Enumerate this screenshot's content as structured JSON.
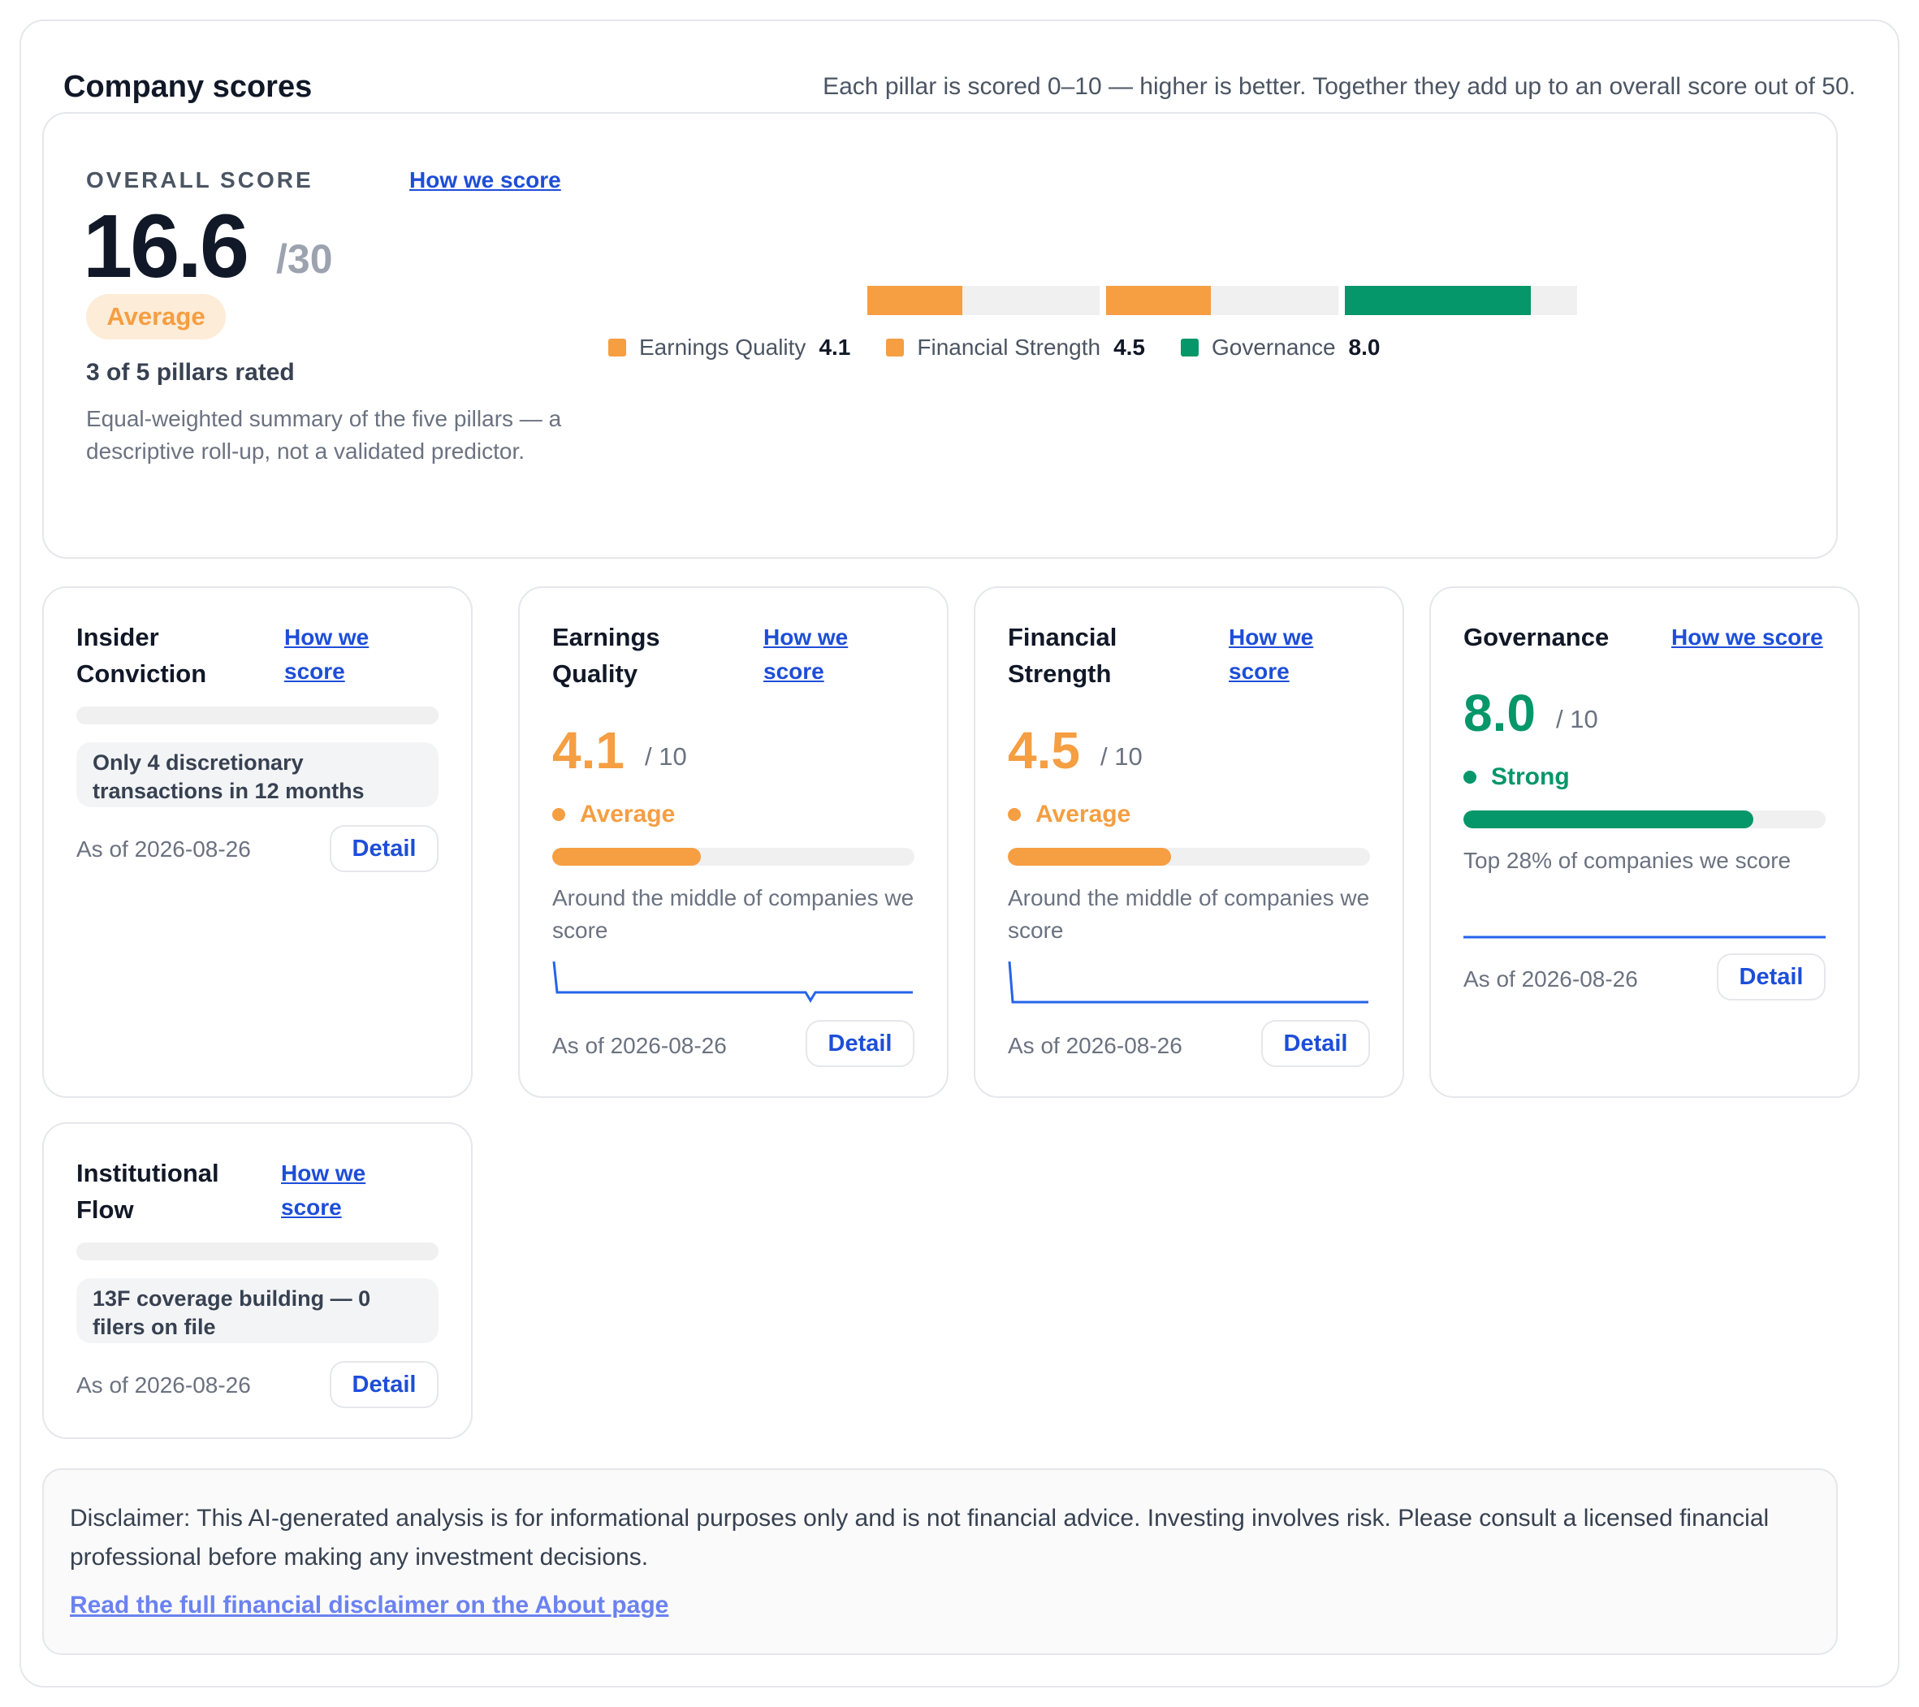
{
  "header": {
    "title": "Company scores",
    "subtitle": "Each pillar is scored 0–10 — higher is better. Together they add up to an overall score out of 50."
  },
  "overall": {
    "label": "OVERALL SCORE",
    "link": "How we score",
    "score": "16.6",
    "max": "/30",
    "band": "Average",
    "rated": "3 of 5 pillars rated",
    "description": "Equal-weighted summary of the five pillars — a descriptive roll-up, not a validated predictor.",
    "segments": [
      {
        "name": "Earnings Quality",
        "value": "4.1",
        "fraction": 0.41,
        "color": "#f59e42"
      },
      {
        "name": "Financial Strength",
        "value": "4.5",
        "fraction": 0.45,
        "color": "#f59e42"
      },
      {
        "name": "Governance",
        "value": "8.0",
        "fraction": 0.8,
        "color": "#059669"
      }
    ]
  },
  "pillars": [
    {
      "title": "Insider Conviction",
      "link": "How we score",
      "note": "Only 4 discretionary transactions in 12 months",
      "as_of": "As of 2026-08-26",
      "detail": "Detail"
    },
    {
      "title": "Earnings Quality",
      "link": "How we score",
      "score": "4.1",
      "max": "/ 10",
      "band": "Average",
      "fraction": 0.41,
      "note": "Around the middle of companies we score",
      "as_of": "As of 2026-08-26",
      "detail": "Detail"
    },
    {
      "title": "Financial Strength",
      "link": "How we score",
      "score": "4.5",
      "max": "/ 10",
      "band": "Average",
      "fraction": 0.45,
      "note": "Around the middle of companies we score",
      "as_of": "As of 2026-08-26",
      "detail": "Detail"
    },
    {
      "title": "Governance",
      "link": "How we score",
      "score": "8.0",
      "max": "/ 10",
      "band": "Strong",
      "fraction": 0.8,
      "note": "Top 28% of companies we score",
      "as_of": "As of 2026-08-26",
      "detail": "Detail"
    },
    {
      "title": "Institutional Flow",
      "link": "How we score",
      "note": "13F coverage building — 0 filers on file",
      "as_of": "As of 2026-08-26",
      "detail": "Detail"
    }
  ],
  "colors": {
    "average": "#f59e42",
    "strong": "#059669",
    "link": "#1d4ed8",
    "sparkline": "#2563eb"
  },
  "disclaimer": {
    "text": "Disclaimer: This AI-generated analysis is for informational purposes only and is not financial advice. Investing involves risk. Please consult a licensed financial professional before making any investment decisions.",
    "link": "Read the full financial disclaimer on the About page"
  }
}
